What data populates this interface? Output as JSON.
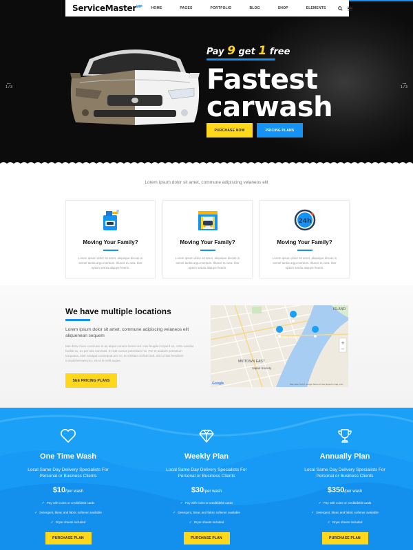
{
  "nav": {
    "logo": "ServiceMaster",
    "logo_sup": "WP",
    "items": [
      "HOME",
      "PAGES",
      "PORTFOLIO",
      "BLOG",
      "SHOP",
      "ELEMENTS"
    ],
    "search_icon": "search-icon",
    "menu_icon": "menu-icon"
  },
  "hero": {
    "prev_slide": "1 / 3",
    "next_slide": "1 / 3",
    "tag_pre": "Pay",
    "tag_num1": "9",
    "tag_mid": "get",
    "tag_num2": "1",
    "tag_post": "free",
    "title_line1": "Fastest",
    "title_line2": "carwash",
    "btn_purchase": "PURCHASE NOW",
    "btn_pricing": "PRICING PLANS"
  },
  "intro": "Lorem ipsum dolor sit amet, commune adipiscing velaneos elit",
  "features": [
    {
      "icon": "car-shampoo-icon",
      "title": "Moving Your Family?",
      "text": "Lorem ipsum dolor sit amet, aliquique discas in semel tantia argu mentum. Illuncit eu sea. Iber option setolu aliquye hearis."
    },
    {
      "icon": "carwash-station-icon",
      "title": "Moving Your Family?",
      "text": "Lorem ipsum dolor sit amet, aliquique discas in semel tantia argu mentum. Illuncit eu sea. Iber option setolu aliquye hearis."
    },
    {
      "icon": "24h-service-icon",
      "title": "Moving Your Family?",
      "text": "Lorem ipsum dolor sit amet, aliquique discas in semel tantia argu mentum. Illuncit eu sea. Iber option setolu aliquye hearis."
    }
  ],
  "locations": {
    "title": "We have multiple locations",
    "lead": "Lorem ipsum dolor sit amet, commune adipiscing velaneos elit aliquenean sequem",
    "body": "Mei dicta choro conclusio ei an atque nonumi ferent vel. Has feugiat inciperit ne, cotra candiut facilisi ex, ex per tota nominati. Et stet cursus petentium his. Per et audiam petentium torquatos, stiet volutpat consequat pro no, te omittam scribet sed. Sit cu hasi hendrerit comprehensam pro, vix ut te velit augue.",
    "button": "SEE PRICING PLANS"
  },
  "map": {
    "labels": [
      "ISLAND",
      "SUTTON PLACE",
      "MIDTOWN EAST",
      "Japan Society",
      "Google"
    ],
    "zoom_in": "+",
    "zoom_out": "−",
    "footer": "Map data ©2017 Google   Terms of Use   Report a map error"
  },
  "pricing": {
    "plans": [
      {
        "icon": "heart-icon",
        "name": "One Time Wash",
        "desc": "Local Same Day Delivery Specialists For Personal or Business Clients",
        "price": "$10",
        "unit": "/per wash",
        "features": [
          "Pay with coins or credit/debit cards",
          "Detergent, bleac and fabric softener available",
          "Dryer sheets included"
        ],
        "button": "PURCHASE PLAN"
      },
      {
        "icon": "diamond-icon",
        "name": "Weekly Plan",
        "desc": "Local Same Day Delivery Specialists For Personal or Business Clients",
        "price": "$30",
        "unit": "/per wash",
        "features": [
          "Pay with coins or credit/debit cards",
          "Detergent, bleac and fabric softener available",
          "Dryer sheets included"
        ],
        "button": "PURCHASE PLAN"
      },
      {
        "icon": "trophy-icon",
        "name": "Annually Plan",
        "desc": "Local Same Day Delivery Specialists For Personal or Business Clients",
        "price": "$350",
        "unit": "/per wash",
        "features": [
          "Pay with coins or credit/debit cards",
          "Detergent, bleac and fabric softener available",
          "Dryer sheets included"
        ],
        "button": "PURCHASE PLAN"
      }
    ]
  },
  "colors": {
    "accent_blue": "#1493f4",
    "accent_yellow": "#ffd81c",
    "pricing_bg": "#1ba0f8"
  }
}
